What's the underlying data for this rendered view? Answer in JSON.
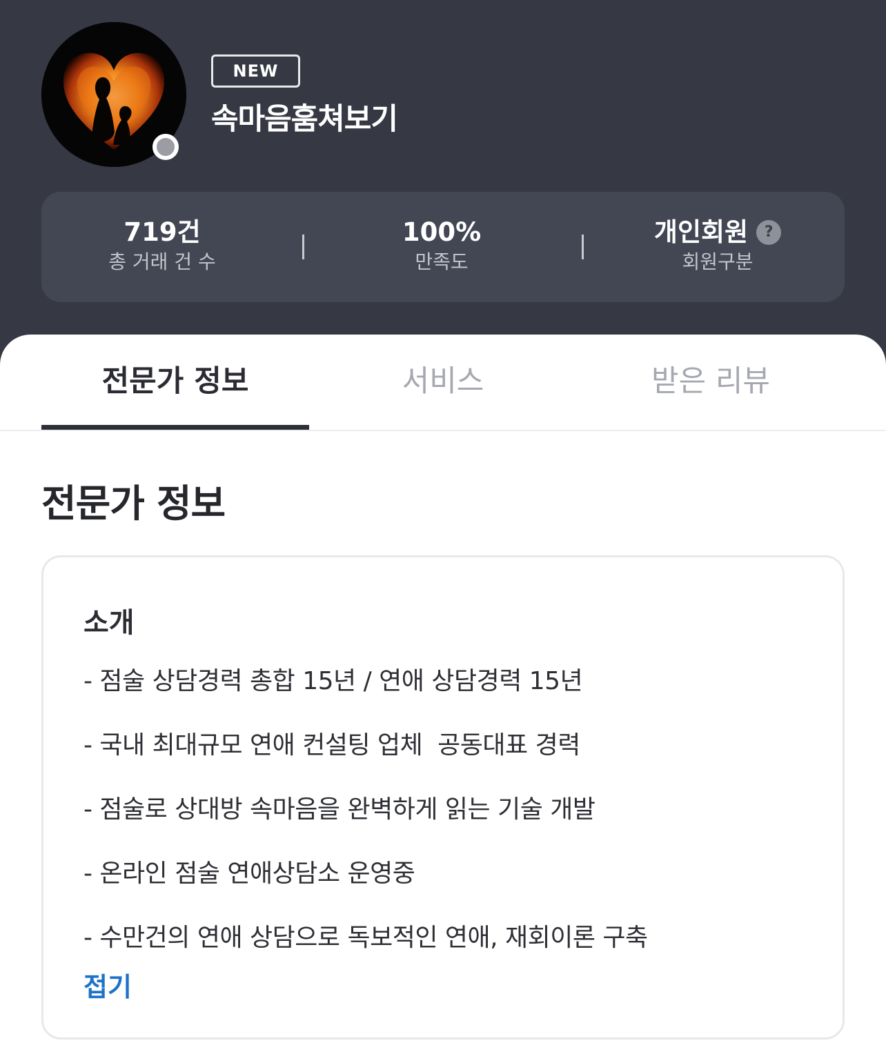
{
  "profile": {
    "badge": "NEW",
    "nickname": "속마음훔쳐보기",
    "avatar_icon": "fire-heart-silhouette-avatar",
    "status_color": "#9c9da3"
  },
  "stats": {
    "transactions_value": "719건",
    "transactions_label": "총 거래 건 수",
    "satisfaction_value": "100%",
    "satisfaction_label": "만족도",
    "member_type_value": "개인회원",
    "member_type_label": "회원구분",
    "help_icon_glyph": "?"
  },
  "tabs": [
    {
      "label": "전문가 정보",
      "active": true
    },
    {
      "label": "서비스",
      "active": false
    },
    {
      "label": "받은 리뷰",
      "active": false
    }
  ],
  "section": {
    "title": "전문가 정보"
  },
  "intro": {
    "title": "소개",
    "lines": [
      "- 점술 상담경력 총합 15년 / 연애 상담경력 15년",
      "- 국내 최대규모 연애 컨설팅 업체  공동대표 경력",
      "- 점술로 상대방 속마음을 완벽하게 읽는 기술 개발",
      "- 온라인 점술 연애상담소 운영중",
      "- 수만건의 연애 상담으로 독보적인 연애, 재회이론 구축"
    ],
    "fold_label": "접기"
  },
  "colors": {
    "header_bg": "#363944",
    "stats_bg": "#434653",
    "accent_link": "#1e73c9",
    "active_tab": "#2b2c33",
    "inactive_tab": "#a6a8b0"
  }
}
